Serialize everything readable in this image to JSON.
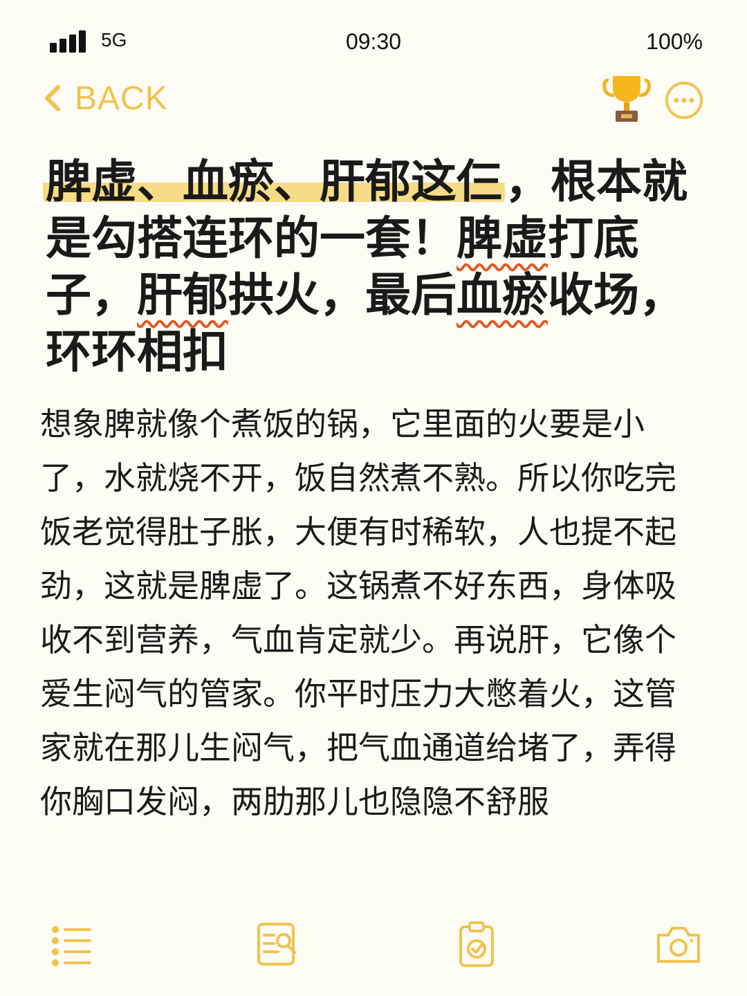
{
  "status_bar": {
    "network": "5G",
    "time": "09:30",
    "battery": "100%"
  },
  "nav": {
    "back_label": "BACK"
  },
  "title": {
    "seg1": "脾虚、血瘀、肝郁这仨",
    "seg2": "，根本就是勾搭连环的一套！",
    "seg3": "脾虚",
    "seg4": "打底子，",
    "seg5": "肝郁",
    "seg6": "拱火，最后",
    "seg7": "血瘀",
    "seg8": "收场，环环相扣"
  },
  "body": {
    "text": "想象脾就像个煮饭的锅，它里面的火要是小了，水就烧不开，饭自然煮不熟。所以你吃完饭老觉得肚子胀，大便有时稀软，人也提不起劲，这就是脾虚了。这锅煮不好东西，身体吸收不到营养，气血肯定就少。再说肝，它像个爱生闷气的管家。你平时压力大憋着火，这管家就在那儿生闷气，把气血通道给堵了，弄得你胸口发闷，两肋那儿也隐隐不舒服"
  },
  "toolbar": {
    "items": [
      "list-icon",
      "search-document-icon",
      "clipboard-check-icon",
      "camera-icon"
    ]
  },
  "colors": {
    "accent": "#f1c24f",
    "highlight": "#f6dc86",
    "wavy_underline": "#e05a27",
    "background": "#fdfcf5"
  }
}
